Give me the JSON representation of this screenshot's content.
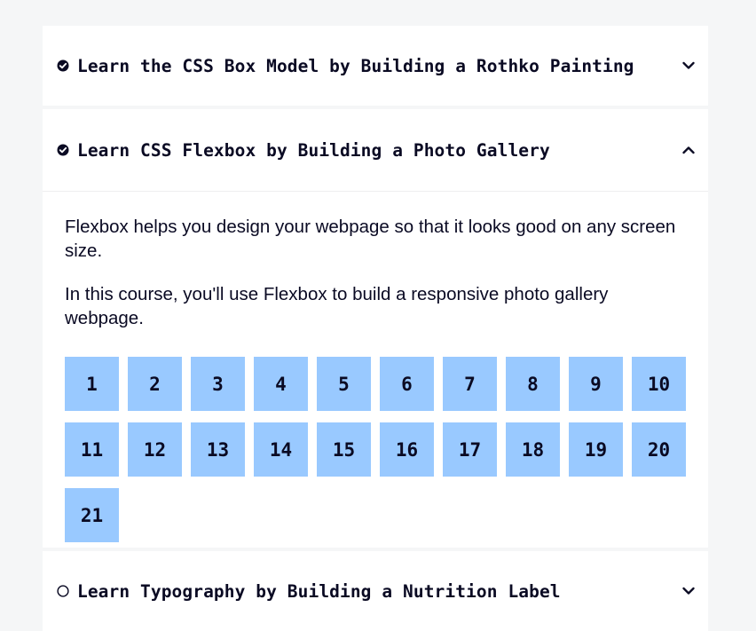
{
  "blocks": [
    {
      "title": "Learn the CSS Box Model by Building a Rothko Painting",
      "status": "completed",
      "status_icon": "check-circle-icon",
      "expanded": false
    },
    {
      "title": "Learn CSS Flexbox by Building a Photo Gallery",
      "status": "completed",
      "status_icon": "check-circle-icon",
      "expanded": true,
      "description": [
        "Flexbox helps you design your webpage so that it looks good on any screen size.",
        "In this course, you'll use Flexbox to build a responsive photo gallery webpage."
      ],
      "steps": [
        "1",
        "2",
        "3",
        "4",
        "5",
        "6",
        "7",
        "8",
        "9",
        "10",
        "11",
        "12",
        "13",
        "14",
        "15",
        "16",
        "17",
        "18",
        "19",
        "20",
        "21"
      ]
    },
    {
      "title": "Learn Typography by Building a Nutrition Label",
      "status": "not-started",
      "status_icon": "empty-circle-icon",
      "expanded": false
    }
  ],
  "colors": {
    "page_background": "#f5f6f7",
    "block_background": "#ffffff",
    "step_background": "#99c9ff",
    "text": "#0a0a23"
  }
}
